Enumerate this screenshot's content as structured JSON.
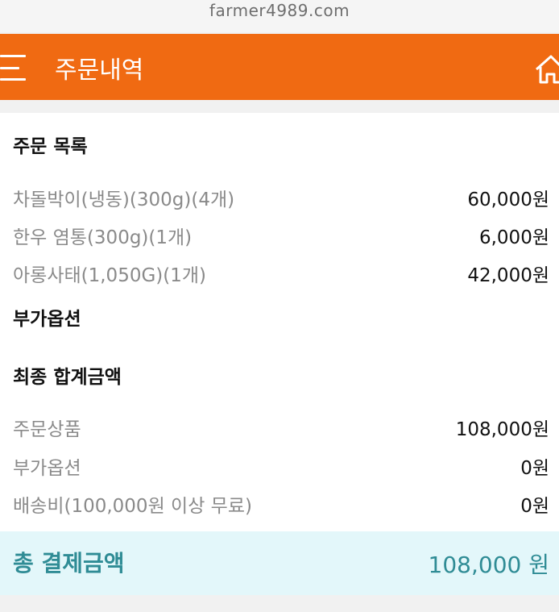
{
  "browser": {
    "url": "farmer4989.com"
  },
  "header": {
    "title": "주문내역",
    "menu_icon": "hamburger-icon",
    "home_icon": "home-icon",
    "color": "#f06a12"
  },
  "order_list": {
    "title": "주문 목록",
    "items": [
      {
        "name": "차돌박이(냉동)(300g)(4개)",
        "price": "60,000원"
      },
      {
        "name": "한우 염통(300g)(1개)",
        "price": "6,000원"
      },
      {
        "name": "아롱사태(1,050G)(1개)",
        "price": "42,000원"
      }
    ]
  },
  "options": {
    "title": "부가옵션"
  },
  "summary": {
    "title": "최종 합계금액",
    "rows": [
      {
        "label": "주문상품",
        "value": "108,000원"
      },
      {
        "label": "부가옵션",
        "value": "0원"
      },
      {
        "label": "배송비(100,000원 이상 무료)",
        "value": "0원"
      }
    ]
  },
  "total": {
    "label": "총 결제금액",
    "value": "108,000 원",
    "color": "#2f8c95",
    "background": "#e3f7fa"
  }
}
